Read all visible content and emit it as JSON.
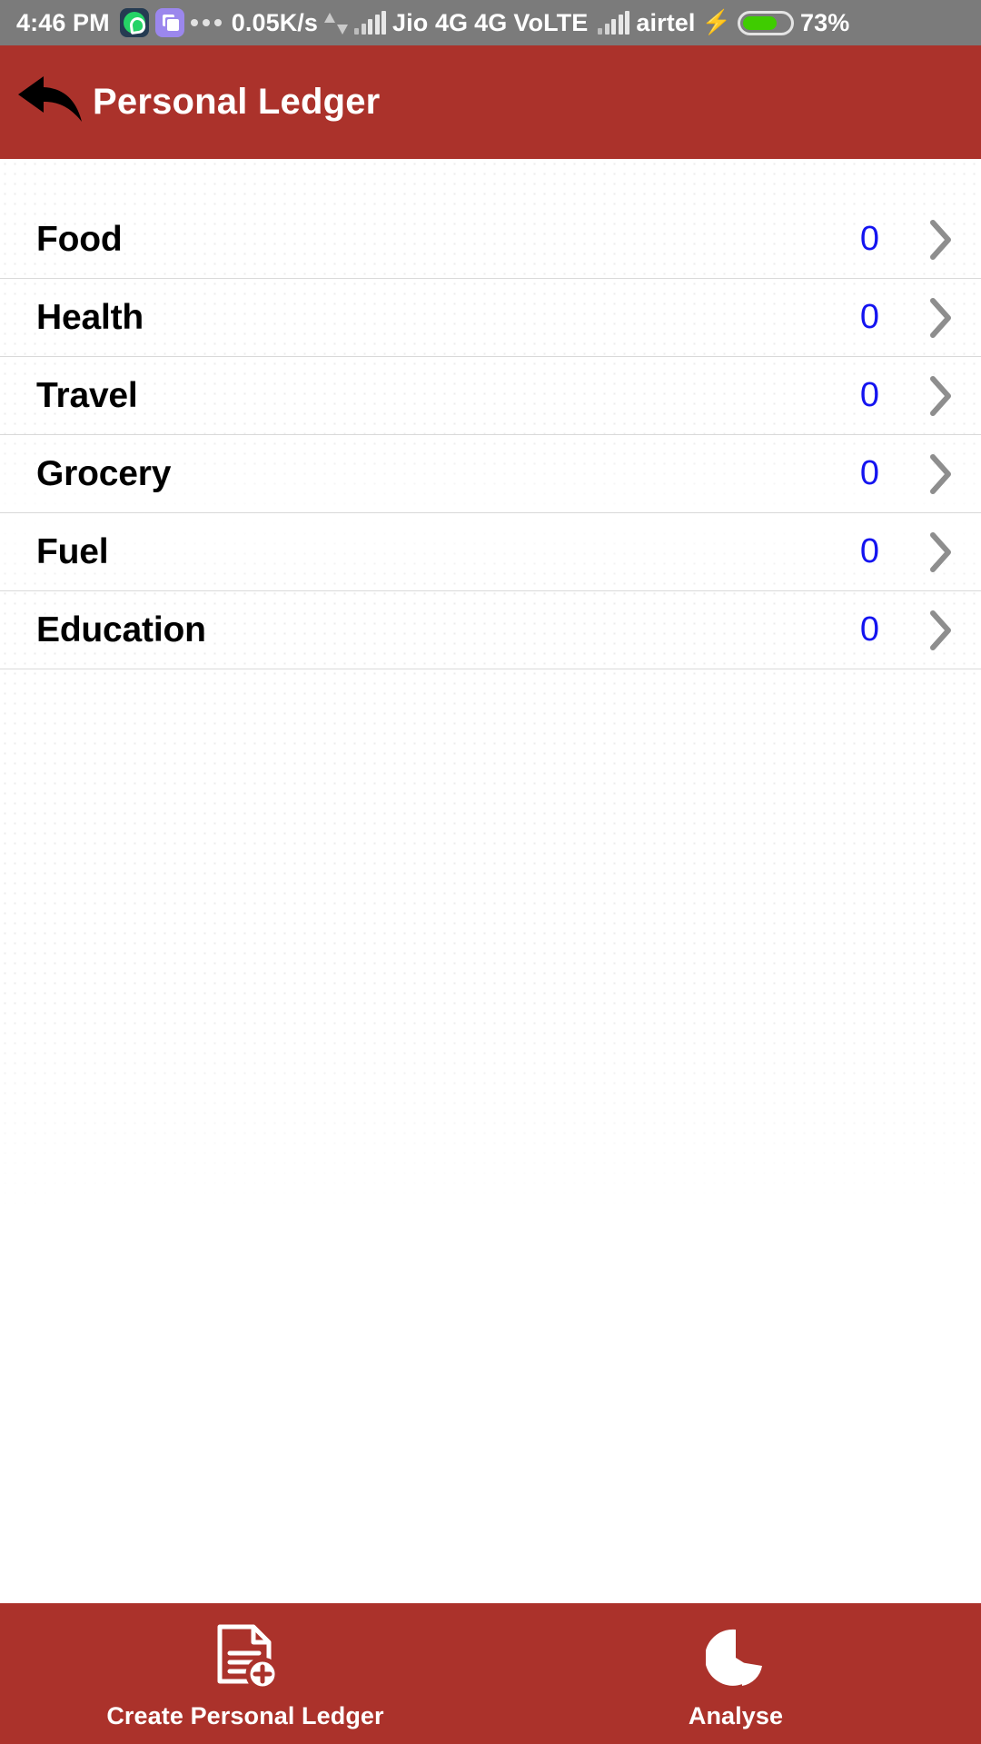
{
  "statusbar": {
    "time": "4:46 PM",
    "app_icons": [
      "whatsapp-icon",
      "purple-app-icon"
    ],
    "overflow_dots": "dots-icon",
    "network_speed": "0.05K/s",
    "data_transfer_icon": "data-transfer-icon",
    "sim1_signal_icon": "signal-bars-icon",
    "sim1_carrier": "Jio 4G",
    "network_type": "4G",
    "volte": "VoLTE",
    "sim2_signal_icon": "signal-bars-icon",
    "sim2_carrier": "airtel",
    "charging_icon": "charging-bolt-icon",
    "battery_percent": "73%",
    "battery_level": 73,
    "battery_color": "#3fcc00",
    "bar_background": "#7b7b7b"
  },
  "header": {
    "back_icon": "back-arrow-icon",
    "title": "Personal Ledger",
    "accent_color": "#ab322b",
    "title_color": "#ffffff"
  },
  "main": {
    "value_color": "#1414f0",
    "chevron_icon": "chevron-right-icon",
    "categories": [
      {
        "label": "Food",
        "value": "0"
      },
      {
        "label": "Health",
        "value": "0"
      },
      {
        "label": "Travel",
        "value": "0"
      },
      {
        "label": "Grocery",
        "value": "0"
      },
      {
        "label": "Fuel",
        "value": "0"
      },
      {
        "label": "Education",
        "value": "0"
      }
    ]
  },
  "bottomnav": {
    "background": "#ab322b",
    "items": [
      {
        "label": "Create Personal Ledger",
        "icon": "document-add-icon"
      },
      {
        "label": "Analyse",
        "icon": "pie-chart-icon"
      }
    ]
  }
}
